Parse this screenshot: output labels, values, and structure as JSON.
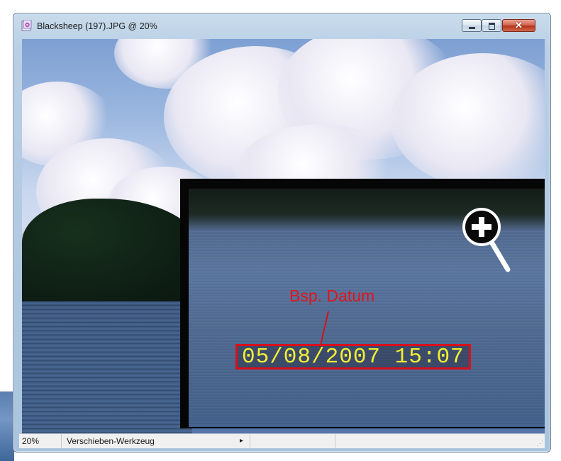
{
  "window": {
    "title": "Blacksheep (197).JPG @ 20%",
    "buttons": {
      "minimize": "minimize",
      "maximize": "maximize",
      "close": "✕"
    }
  },
  "overlay": {
    "label": "Bsp. Datum",
    "date_stamp": "05/08/2007  15:07",
    "date_stamp_color": "#f2ee34",
    "annotation_color": "#e0141c",
    "icon": "zoom-in-icon"
  },
  "statusbar": {
    "zoom": "20%",
    "tool": "Verschieben-Werkzeug",
    "menu_arrow": "▸"
  }
}
